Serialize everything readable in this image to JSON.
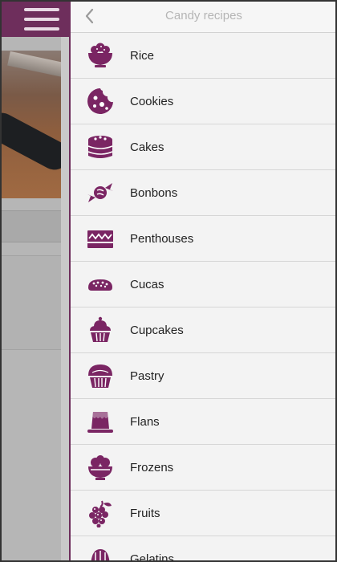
{
  "drawer": {
    "title": "Candy recipes",
    "back_icon": "chevron-left-icon",
    "accent_color": "#6e2e5c",
    "items": [
      {
        "label": "Rice",
        "icon": "rice-bowl-icon"
      },
      {
        "label": "Cookies",
        "icon": "cookie-icon"
      },
      {
        "label": "Cakes",
        "icon": "cake-icon"
      },
      {
        "label": "Bonbons",
        "icon": "candy-icon"
      },
      {
        "label": "Penthouses",
        "icon": "layer-cake-icon"
      },
      {
        "label": "Cucas",
        "icon": "bread-icon"
      },
      {
        "label": "Cupcakes",
        "icon": "cupcake-icon"
      },
      {
        "label": "Pastry",
        "icon": "muffin-icon"
      },
      {
        "label": "Flans",
        "icon": "flan-icon"
      },
      {
        "label": "Frozens",
        "icon": "ice-cream-bowl-icon"
      },
      {
        "label": "Fruits",
        "icon": "grapes-icon"
      },
      {
        "label": "Gelatins",
        "icon": "gelatin-icon"
      }
    ]
  },
  "background_app": {
    "menu_icon": "hamburger-menu-icon"
  }
}
